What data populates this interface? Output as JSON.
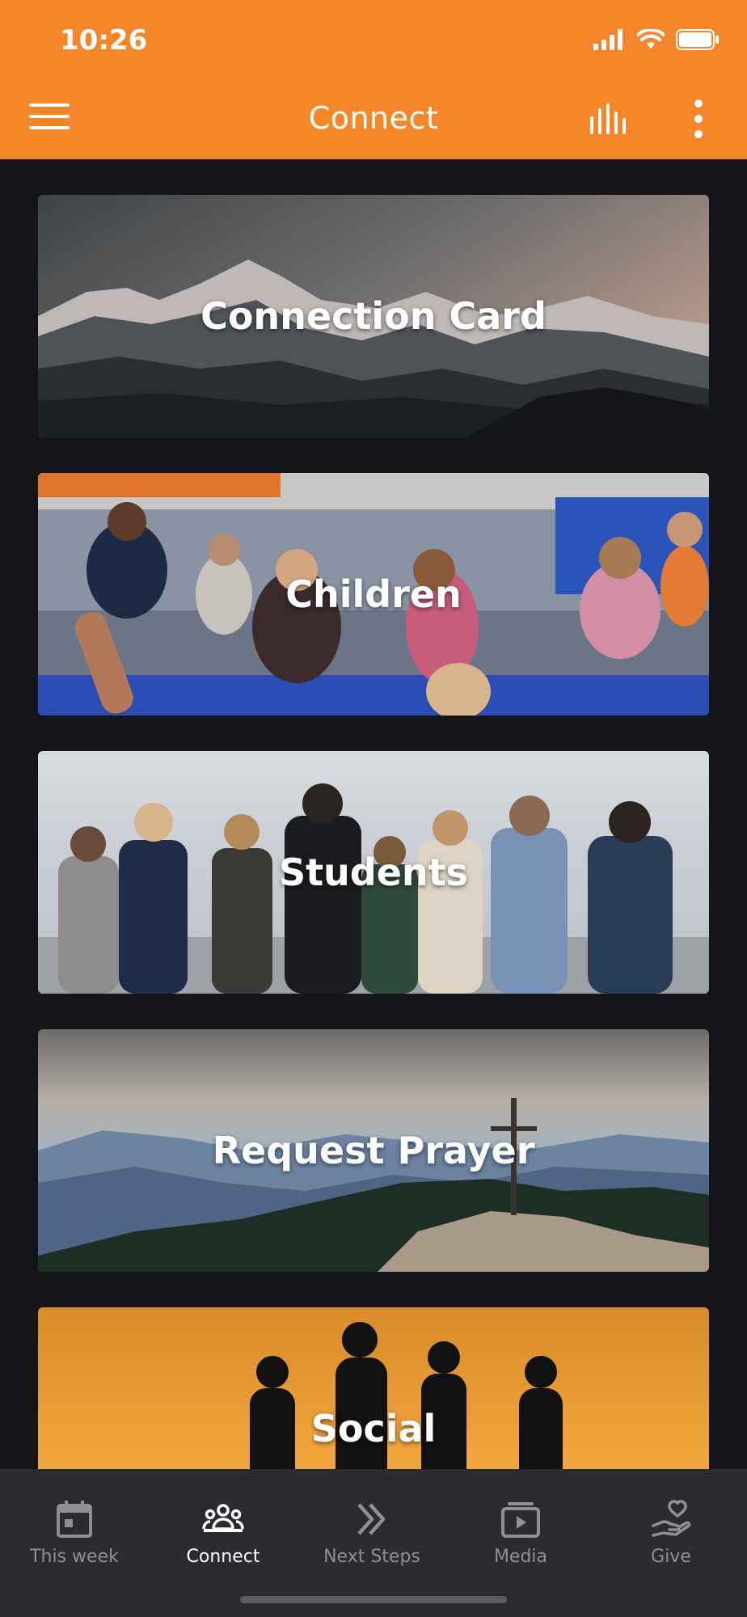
{
  "status": {
    "time": "10:26"
  },
  "header": {
    "title": "Connect"
  },
  "cards": [
    {
      "title": "Connection Card"
    },
    {
      "title": "Children"
    },
    {
      "title": "Students"
    },
    {
      "title": "Request Prayer"
    },
    {
      "title": "Social"
    }
  ],
  "nav": {
    "items": [
      {
        "label": "This week",
        "icon": "calendar-icon"
      },
      {
        "label": "Connect",
        "icon": "people-icon",
        "active": true
      },
      {
        "label": "Next Steps",
        "icon": "chevrons-right-icon"
      },
      {
        "label": "Media",
        "icon": "media-icon"
      },
      {
        "label": "Give",
        "icon": "give-icon"
      }
    ]
  },
  "colors": {
    "accent": "#f5862a",
    "background": "#141518",
    "nav_bg": "#2b2c30",
    "nav_inactive": "#8f9096"
  }
}
